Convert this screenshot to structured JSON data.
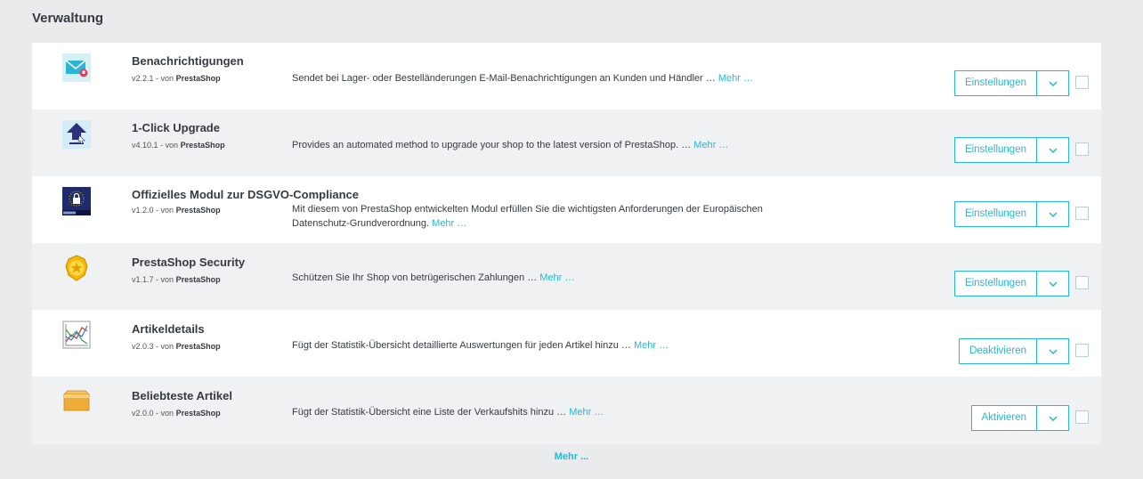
{
  "section": {
    "title": "Verwaltung"
  },
  "modules": [
    {
      "name": "Benachrichtigungen",
      "version": "v2.2.1",
      "by": "- von",
      "author": "PrestaShop",
      "description": "Sendet bei Lager- oder Bestelländerungen E-Mail-Benachrichtigungen an Kunden und Händler …",
      "more": "Mehr …",
      "action": "Einstellungen",
      "icon": "mail-alert-icon"
    },
    {
      "name": "1-Click Upgrade",
      "version": "v4.10.1",
      "by": "- von",
      "author": "PrestaShop",
      "description": "Provides an automated method to upgrade your shop to the latest version of PrestaShop. …",
      "more": "Mehr …",
      "action": "Einstellungen",
      "icon": "upgrade-arrow-icon"
    },
    {
      "name": "Offizielles Modul zur DSGVO-Compliance",
      "version": "v1.2.0",
      "by": "- von",
      "author": "PrestaShop",
      "description": "Mit diesem von PrestaShop entwickelten Modul erfüllen Sie die wichtigsten Anforderungen der Europäischen Datenschutz-Grundverordnung.",
      "more": "Mehr …",
      "action": "Einstellungen",
      "icon": "gdpr-lock-icon"
    },
    {
      "name": "PrestaShop Security",
      "version": "v1.1.7",
      "by": "- von",
      "author": "PrestaShop",
      "description": "Schützen Sie Ihr Shop von betrügerischen Zahlungen …",
      "more": "Mehr …",
      "action": "Einstellungen",
      "icon": "security-badge-icon"
    },
    {
      "name": "Artikeldetails",
      "version": "v2.0.3",
      "by": "- von",
      "author": "PrestaShop",
      "description": "Fügt der Statistik-Übersicht detaillierte Auswertungen für jeden Artikel hinzu …",
      "more": "Mehr …",
      "action": "Deaktivieren",
      "icon": "stats-chart-icon"
    },
    {
      "name": "Beliebteste Artikel",
      "version": "v2.0.0",
      "by": "- von",
      "author": "PrestaShop",
      "description": "Fügt der Statistik-Übersicht eine Liste der Verkaufshits hinzu …",
      "more": "Mehr …",
      "action": "Aktivieren",
      "icon": "box-icon"
    }
  ],
  "footer": {
    "more": "Mehr ..."
  },
  "colors": {
    "accent": "#25b9d7",
    "row_alt": "#eff1f2",
    "background": "#eaebec"
  }
}
